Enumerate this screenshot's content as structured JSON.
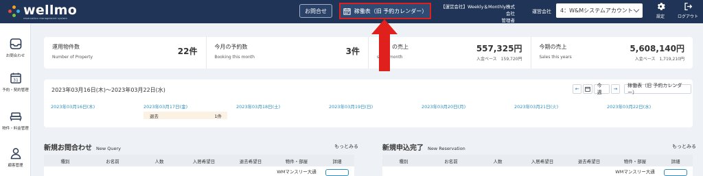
{
  "app": {
    "logo_text": "wellmo",
    "logo_tagline": "reservation management system"
  },
  "header": {
    "inquiry_label": "お問合せ",
    "calendar_label": "稼働表（旧 予約カレンダー）",
    "company_line1": "【運営会社】Weekly＆Monthly株式会社",
    "company_line2": "管理者",
    "company_select_label": "運営会社",
    "company_select_value": "4：W&Mシステムアカウント",
    "settings_label": "設定",
    "logout_label": "ログアウト"
  },
  "sidebar": {
    "items": [
      {
        "label": "お問合わせ",
        "icon": "inbox-icon"
      },
      {
        "label": "予約・契約管理",
        "icon": "calendar-icon",
        "icon_text": "31"
      },
      {
        "label": "物件・料金管理",
        "icon": "bed-icon"
      },
      {
        "label": "顧客管理",
        "icon": "user-icon"
      }
    ]
  },
  "stats": [
    {
      "title": "運用物件数",
      "subtitle": "Number of Property",
      "value": "22件",
      "basis": ""
    },
    {
      "title": "今月の予約数",
      "subtitle": "Booking this month",
      "value": "3件",
      "basis": ""
    },
    {
      "title": "の売上",
      "subtitle": "s this month",
      "value": "557,325円",
      "basis": "入金ベース　159,720円"
    },
    {
      "title": "今期の売上",
      "subtitle": "Sales this years",
      "value": "5,608,140円",
      "basis": "入金ベース　1,719,210円"
    }
  ],
  "calendar": {
    "range": "2023年03月16日(木)〜2023年03月22日(水)",
    "prev_label": "←",
    "today_label": "今週",
    "next_label": "→",
    "calendar_button": "稼働表（旧 予約カレンダー）",
    "days": [
      "2023年03月16日(木)",
      "2023年03月17日(金)",
      "2023年03月18日(土)",
      "2023年03月19日(日)",
      "2023年03月20日(月)",
      "2023年03月21日(火)",
      "2023年03月22日(水)"
    ],
    "event": {
      "label": "退去",
      "count": "1件"
    }
  },
  "new_query": {
    "title": "新規お問合わせ",
    "subtitle": "New Query",
    "more": "もっとみる",
    "columns": [
      "種別",
      "お名前",
      "人数",
      "入居希望日",
      "退去希望日",
      "物件・部屋",
      "詳細"
    ],
    "row_partial": "WMマンスリー大通"
  },
  "new_reservation": {
    "title": "新規申込完了",
    "subtitle": "New Reservation",
    "more": "もっとみる",
    "columns": [
      "種別",
      "お名前",
      "人数",
      "入居希望日",
      "退去希望日",
      "物件・部屋",
      "詳細"
    ],
    "row_partial": "WMマンスリー大通"
  },
  "colors": {
    "header_bg": "#1f3456",
    "accent_blue": "#2a8fbf",
    "highlight_red": "#e0201c"
  }
}
